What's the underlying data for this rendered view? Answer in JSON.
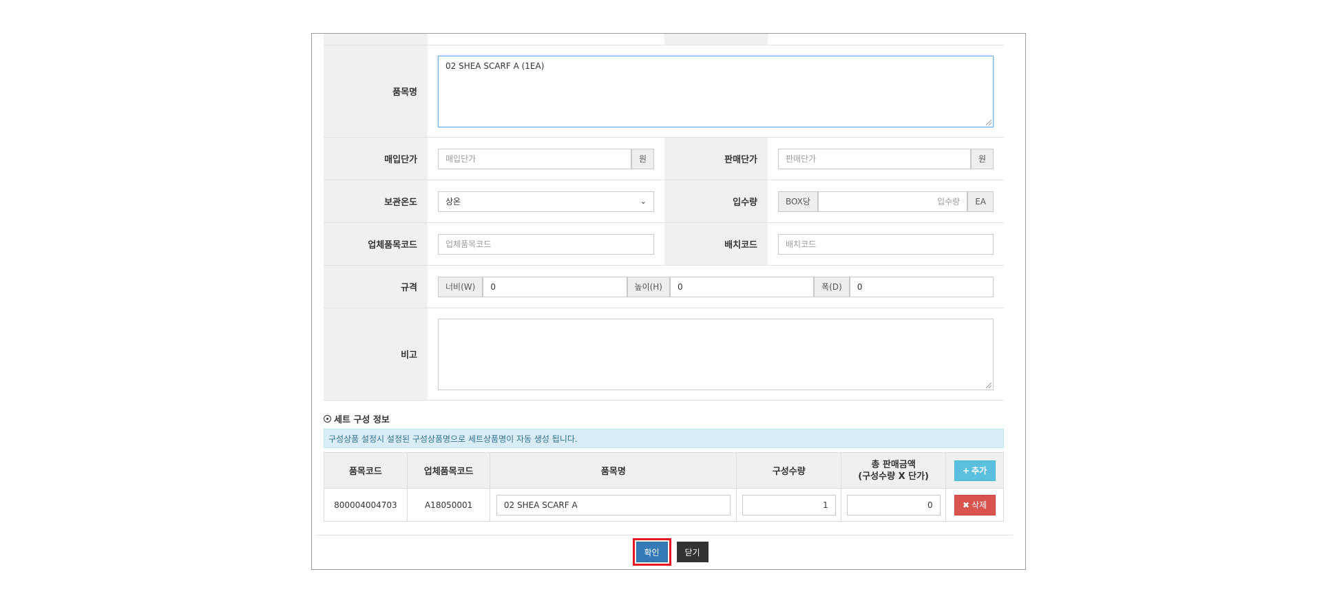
{
  "form": {
    "item_name_label": "품목명",
    "item_name_value": "02 SHEA SCARF A (1EA)",
    "purchase_price_label": "매입단가",
    "purchase_price_placeholder": "매입단가",
    "purchase_price_unit": "원",
    "sale_price_label": "판매단가",
    "sale_price_placeholder": "판매단가",
    "sale_price_unit": "원",
    "storage_temp_label": "보관온도",
    "storage_temp_value": "상온",
    "pack_qty_label": "입수량",
    "pack_qty_prefix": "BOX당",
    "pack_qty_placeholder": "입수량",
    "pack_qty_unit": "EA",
    "vendor_code_label": "업체품목코드",
    "vendor_code_placeholder": "업체품목코드",
    "barcode_label": "배치코드",
    "barcode_placeholder": "배치코드",
    "spec_label": "규격",
    "width_label": "너비(W)",
    "width_value": "0",
    "height_label": "높이(H)",
    "height_value": "0",
    "depth_label": "폭(D)",
    "depth_value": "0",
    "remarks_label": "비고",
    "remarks_value": ""
  },
  "set_section": {
    "title": "세트 구성 정보",
    "info_text": "구성상품 설정시 설정된 구성상품명으로 세트상품명이 자동 생성 됩니다.",
    "headers": {
      "item_code": "품목코드",
      "vendor_code": "업체품목코드",
      "item_name": "품목명",
      "qty": "구성수량",
      "total_line1": "총 판매금액",
      "total_line2": "(구성수량 X 단가)"
    },
    "add_label": "추가",
    "rows": [
      {
        "item_code": "800004004703",
        "vendor_code": "A18050001",
        "item_name": "02 SHEA SCARF A",
        "qty": "1",
        "total": "0",
        "delete_label": "삭제"
      }
    ]
  },
  "footer": {
    "confirm_label": "확인",
    "close_label": "닫기"
  },
  "colors": {
    "confirm_highlight": "#e8141f",
    "primary": "#337ab7",
    "info": "#5bc0de",
    "danger": "#d9534f"
  }
}
